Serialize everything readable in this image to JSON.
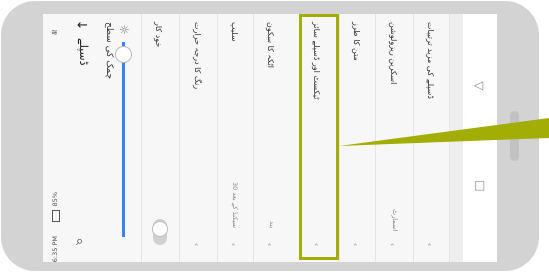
{
  "status_bar": {
    "time": "6:35 PM",
    "battery": "85%"
  },
  "header": {
    "title": "ڈسپلے",
    "back_icon": "arrow-back-icon",
    "search_icon": "search-icon"
  },
  "brightness": {
    "title": "چمک کی سطح",
    "auto_label": "خود کار",
    "level": 0.15
  },
  "items": [
    {
      "label": "رنگ کا درجہ حرارت",
      "value": ""
    },
    {
      "label": "سلیپ",
      "value": "30 سیکنڈ کے بعد"
    },
    {
      "label": "اٹکہ کا سکون",
      "value": "بند"
    },
    {
      "label": "ٹیکسٹ اور ڈسپلے سائز",
      "value": ""
    },
    {
      "label": "متن کا طرز",
      "value": ""
    },
    {
      "label": "اسکرین ریزولوشن",
      "value": "اسمارٹ"
    },
    {
      "label": "ڈسپلے کی مزید ترتیبات",
      "value": ""
    }
  ],
  "colors": {
    "frame": "#d3d3d3",
    "accent": "#a2ad05",
    "slider": "#3d82f2"
  }
}
